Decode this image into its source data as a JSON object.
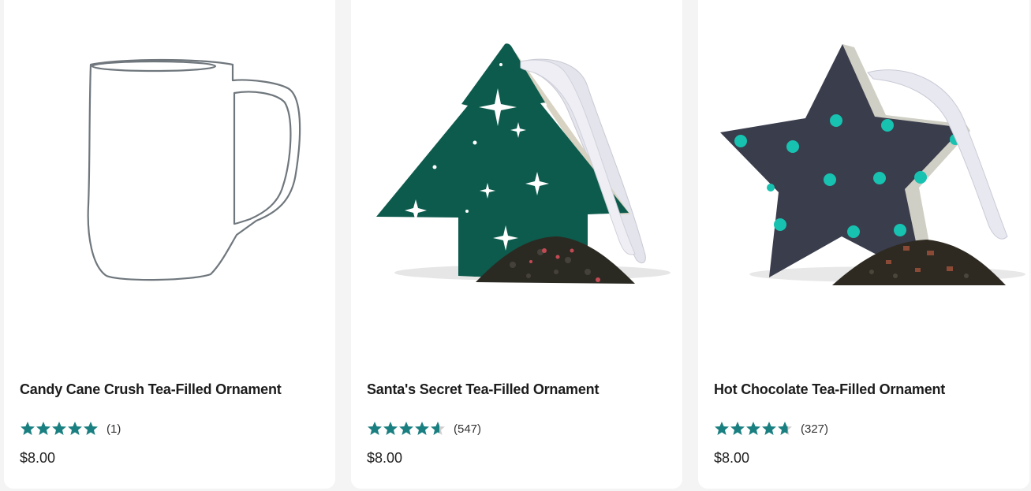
{
  "colors": {
    "star_fill": "#1a7f80",
    "star_empty": "#cfcfcf",
    "tree_green": "#0d5b4d",
    "star_navy": "#3a3d4c",
    "dot_teal": "#17c2b0"
  },
  "products": [
    {
      "title": "Candy Cane Crush Tea-Filled Ornament",
      "image": "mug-outline-placeholder",
      "rating": 5.0,
      "review_count": "(1)",
      "price": "$8.00"
    },
    {
      "title": "Santa's Secret Tea-Filled Ornament",
      "image": "green-tree-ornament",
      "rating": 4.6,
      "review_count": "(547)",
      "price": "$8.00"
    },
    {
      "title": "Hot Chocolate Tea-Filled Ornament",
      "image": "navy-star-ornament",
      "rating": 4.7,
      "review_count": "(327)",
      "price": "$8.00"
    }
  ]
}
